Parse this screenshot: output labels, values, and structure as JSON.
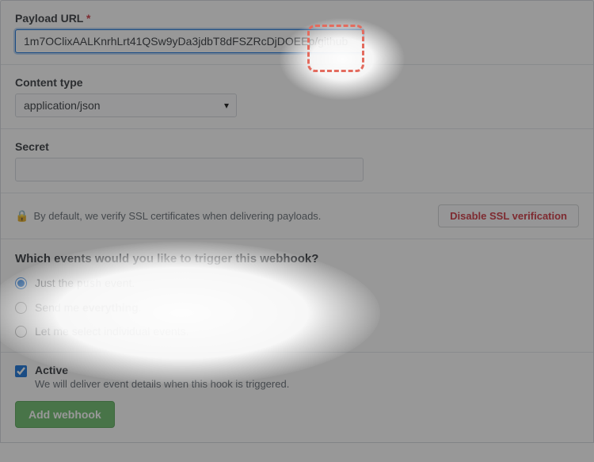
{
  "payload_url": {
    "label": "Payload URL",
    "required_marker": "*",
    "value": "1m7OClixAALKnrhLrt41QSw9yDa3jdbT8dFSZRcDjDOEEp/github"
  },
  "content_type": {
    "label": "Content type",
    "selected": "application/json"
  },
  "secret": {
    "label": "Secret",
    "value": ""
  },
  "ssl": {
    "text": "By default, we verify SSL certificates when delivering payloads.",
    "disable_button": "Disable SSL verification"
  },
  "events": {
    "heading": "Which events would you like to trigger this webhook?",
    "options": {
      "push_prefix": "Just the ",
      "push_code": "push",
      "push_suffix": " event.",
      "everything_prefix": "Send me ",
      "everything_bold": "everything",
      "everything_suffix": ".",
      "individual": "Let me select individual events."
    }
  },
  "active": {
    "label": "Active",
    "description": "We will deliver event details when this hook is triggered."
  },
  "submit": {
    "label": "Add webhook"
  }
}
